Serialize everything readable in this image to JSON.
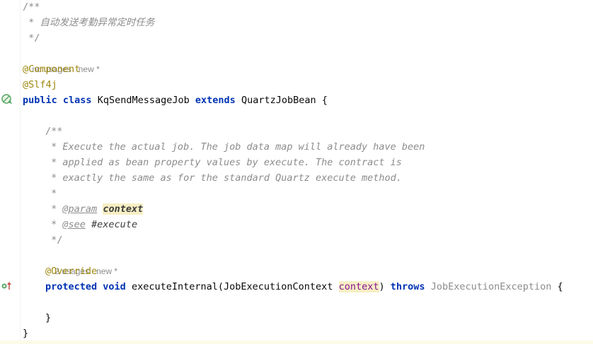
{
  "comment_header": {
    "open": "/**",
    "text": " * 自动发送考勤异常定时任务",
    "close": " */"
  },
  "class_hint": {
    "usages": "no usages",
    "author": "new *"
  },
  "annotations": {
    "component": "@Component",
    "slf4j": "@Slf4j"
  },
  "class_decl": {
    "kw_public": "public",
    "kw_class": "class",
    "name": "KqSendMessageJob",
    "kw_extends": "extends",
    "super": "QuartzJobBean",
    "open_brace": "{"
  },
  "javadoc": {
    "open": "/**",
    "line1": " * Execute the actual job. The job data map will already have been",
    "line2": " * applied as bean property values by execute. The contract is",
    "line3": " * exactly the same as for the standard Quartz execute method.",
    "blank": " *",
    "param_prefix": " * ",
    "param_tag": "@param",
    "param_name": "context",
    "see_prefix": " * ",
    "see_tag": "@see",
    "see_ref": "#execute",
    "close": " */"
  },
  "method_hint": {
    "usages": "2 usages",
    "author": "new *"
  },
  "override": "@Override",
  "method_decl": {
    "kw_protected": "protected",
    "kw_void": "void",
    "name": "executeInternal",
    "paren_open": "(",
    "param_type": "JobExecutionContext",
    "param_name": "context",
    "paren_close": ")",
    "kw_throws": "throws",
    "exception": "JobExecutionException",
    "open_brace": "{"
  },
  "method_close": "}",
  "class_close": "}",
  "colors": {
    "keyword": "#0033b3",
    "annotation": "#9e880d",
    "comment": "#8c8c8c",
    "highlight": "#f7efc4",
    "parameter": "#871094"
  },
  "icons": {
    "class_gutter": "no-overrides-circle-icon",
    "method_gutter": "overrides-method-up-arrow-icon"
  }
}
